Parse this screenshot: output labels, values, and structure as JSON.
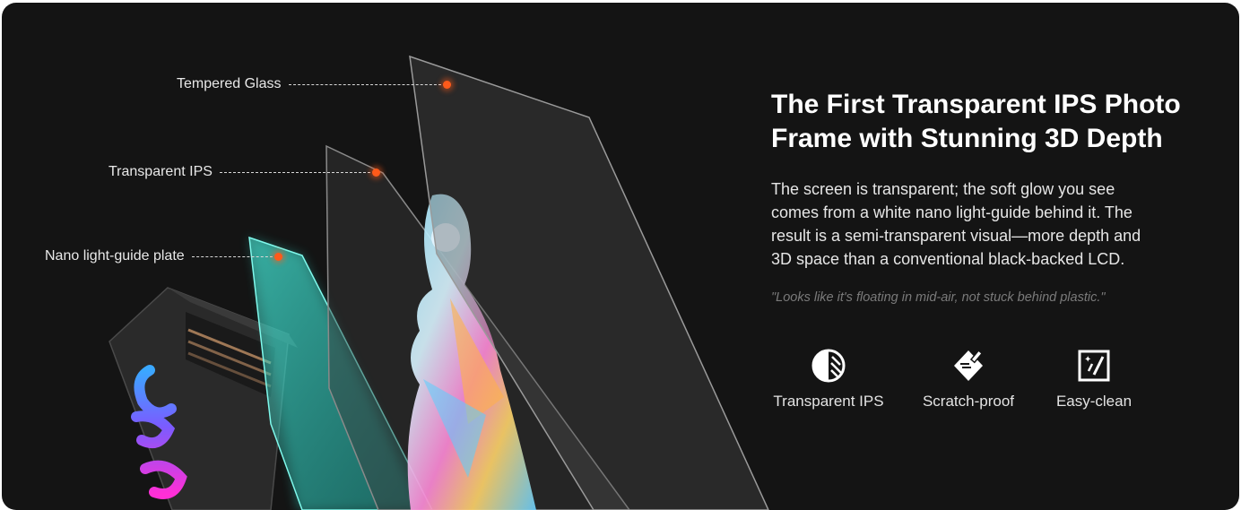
{
  "callouts": {
    "tempered_glass": "Tempered Glass",
    "transparent_ips": "Transparent IPS",
    "light_guide": "Nano light-guide plate"
  },
  "headline": {
    "line1": "The First Transparent IPS Photo",
    "line2": "Frame with Stunning 3D Depth"
  },
  "description": {
    "line1": "The screen is transparent; the soft glow you see",
    "line2": "comes from a white nano light-guide behind it. The",
    "line3": "result is a semi-transparent visual—more depth and",
    "line4": "3D space than a conventional black-backed LCD."
  },
  "quote": "\"Looks like it's floating in mid-air, not stuck behind plastic.\"",
  "features": [
    {
      "label": "Transparent IPS",
      "icon": "transparent-ips-icon"
    },
    {
      "label": "Scratch-proof",
      "icon": "scratch-proof-icon"
    },
    {
      "label": "Easy-clean",
      "icon": "easy-clean-icon"
    }
  ],
  "colors": {
    "background": "#141414",
    "accent_dot": "#ff5a1a",
    "glow": "#2fe0d0"
  }
}
